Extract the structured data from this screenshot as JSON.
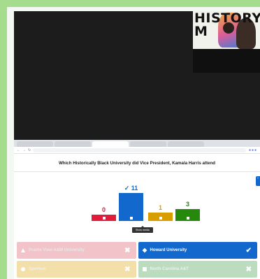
{
  "thumbnail": {
    "logo_line1": "HISTORY",
    "logo_line2": "M"
  },
  "browser": {
    "tabs": [
      "",
      "",
      "",
      "",
      ""
    ],
    "url": ""
  },
  "question": "Which Historically Black University did Vice President, Kamala Harris attend",
  "tooltip": "Show media",
  "results": [
    {
      "count": "0",
      "value": 0,
      "color": "#e21b3c",
      "correct": false,
      "check": ""
    },
    {
      "count": "11",
      "value": 11,
      "color": "#1368ce",
      "correct": true,
      "check": "✓"
    },
    {
      "count": "1",
      "value": 1,
      "color": "#d89e00",
      "correct": false,
      "check": ""
    },
    {
      "count": "3",
      "value": 3,
      "color": "#26890c",
      "correct": false,
      "check": ""
    }
  ],
  "answers": [
    {
      "label": "Prairie View A&M University",
      "state": "incorrect",
      "icon": "✖"
    },
    {
      "label": "Howard University",
      "state": "correct",
      "icon": "✔"
    },
    {
      "label": "Spelman",
      "state": "incorrect",
      "icon": "✖"
    },
    {
      "label": "North Carolina A&T",
      "state": "incorrect",
      "icon": "✖"
    }
  ]
}
